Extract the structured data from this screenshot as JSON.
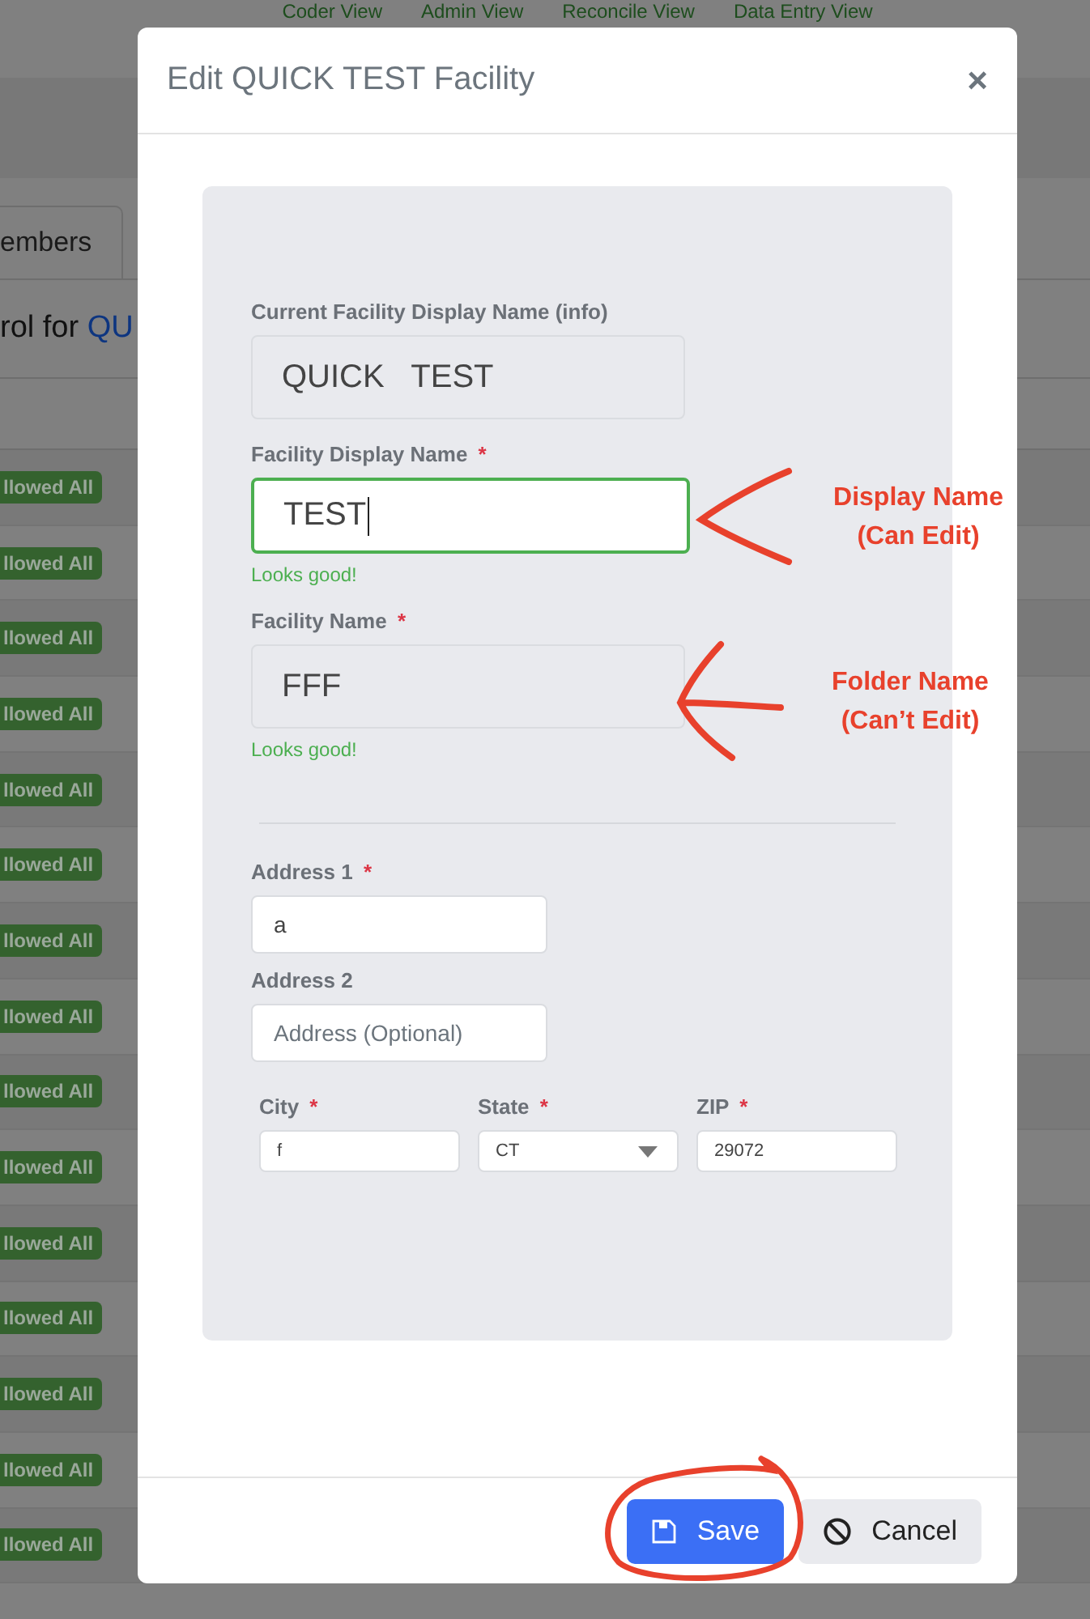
{
  "background": {
    "nav_links": [
      "Coder View",
      "Admin View",
      "Reconcile View",
      "Data Entry View"
    ],
    "tab": {
      "label": "embers",
      "selected": true
    },
    "heading": {
      "text": "rol for ",
      "link": "QU"
    },
    "badges": [
      {
        "text": "llowed All",
        "color": "#34622e"
      },
      {
        "text": "llowed All",
        "color": "#34622e"
      },
      {
        "text": "llowed All",
        "color": "#34622e"
      },
      {
        "text": "llowed All",
        "color": "#34622e"
      },
      {
        "text": "llowed All",
        "color": "#34622e"
      },
      {
        "text": "llowed All",
        "color": "#34622e"
      },
      {
        "text": "llowed All",
        "color": "#34622e"
      },
      {
        "text": "llowed All",
        "color": "#34622e"
      },
      {
        "text": "llowed All",
        "color": "#34622e"
      },
      {
        "text": "llowed All",
        "color": "#34622e"
      },
      {
        "text": "llowed All",
        "color": "#34622e"
      },
      {
        "text": "llowed All",
        "color": "#34622e"
      },
      {
        "text": "llowed All",
        "color": "#34622e"
      },
      {
        "text": "llowed All",
        "color": "#34622e"
      },
      {
        "text": "llowed All",
        "color": "#34622e"
      }
    ]
  },
  "modal": {
    "title": "Edit QUICK TEST Facility",
    "close": "×",
    "identity_fields": [
      {
        "kind": "readonly",
        "label": "Current Facility Display Name (info)",
        "value": "QUICK   TEST"
      },
      {
        "kind": "text",
        "label": "Facility Display Name",
        "required_mark": "*",
        "value": "TEST",
        "focused": true,
        "valid": true,
        "feedback": "Looks good!"
      },
      {
        "kind": "readonly",
        "label": "Facility Name",
        "required_mark": "*",
        "value": "FFF",
        "valid": true,
        "feedback": "Looks good!"
      }
    ],
    "address_fields": [
      {
        "kind": "text",
        "label": "Address 1",
        "required_mark": "*",
        "value": "a"
      },
      {
        "kind": "text",
        "label": "Address 2",
        "placeholder": "Address (Optional)"
      }
    ],
    "location_fields": [
      {
        "kind": "text",
        "label": "City",
        "required_mark": "*",
        "value": "f"
      },
      {
        "kind": "select",
        "label": "State",
        "required_mark": "*",
        "value": "CT"
      },
      {
        "kind": "text",
        "label": "ZIP",
        "required_mark": "*",
        "value": "29072"
      }
    ],
    "buttons": [
      {
        "kind": "save",
        "label": "Save"
      },
      {
        "kind": "cancel",
        "label": "Cancel"
      }
    ]
  },
  "annotations": [
    {
      "kind": "chevron",
      "lines": [
        "Display Name",
        "(Can Edit)"
      ]
    },
    {
      "kind": "arrow",
      "lines": [
        "Folder Name",
        "(Can’t Edit)"
      ]
    },
    {
      "kind": "circle"
    }
  ]
}
